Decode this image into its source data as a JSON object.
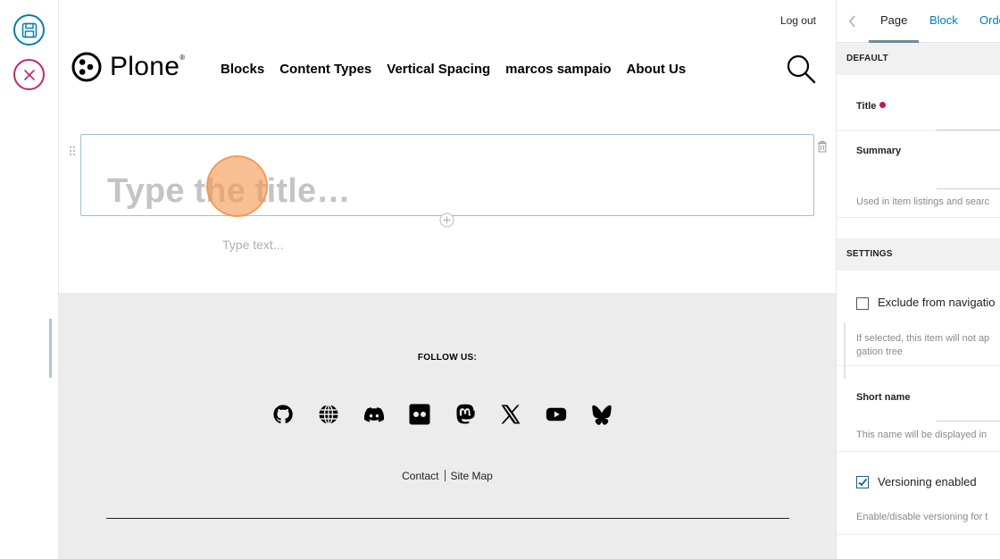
{
  "toolbar": {
    "save_icon": "save-icon",
    "cancel_icon": "close-icon"
  },
  "header": {
    "logout_label": "Log out",
    "logo_text": "Plone",
    "logo_mark": "®",
    "nav": [
      "Blocks",
      "Content Types",
      "Vertical Spacing",
      "marcos sampaio",
      "About Us"
    ]
  },
  "editor": {
    "title_placeholder": "Type the title…",
    "text_placeholder": "Type text..."
  },
  "footer": {
    "follow_label": "FOLLOW US:",
    "social": [
      "github-icon",
      "globe-icon",
      "discord-icon",
      "flickr-icon",
      "mastodon-icon",
      "x-icon",
      "youtube-icon",
      "bluesky-icon"
    ],
    "links": [
      "Contact",
      "Site Map"
    ]
  },
  "sidebar": {
    "tabs": [
      "Page",
      "Block",
      "Orde"
    ],
    "active_tab": "Page",
    "default_header": "DEFAULT",
    "title_label": "Title",
    "summary_label": "Summary",
    "summary_help": "Used in item listings and searc",
    "settings_header": "SETTINGS",
    "exclude_label": "Exclude from navigatio",
    "exclude_checked": false,
    "exclude_help_1": "If selected, this item will not ap",
    "exclude_help_2": "gation tree",
    "short_name_label": "Short name",
    "short_name_help": "This name will be displayed in",
    "versioning_label": "Versioning enabled",
    "versioning_checked": true,
    "versioning_help": "Enable/disable versioning for t"
  },
  "colors": {
    "accent": "#007eb1",
    "danger": "#c2266e",
    "required": "#c2185b",
    "footer_bg": "#ececec"
  }
}
